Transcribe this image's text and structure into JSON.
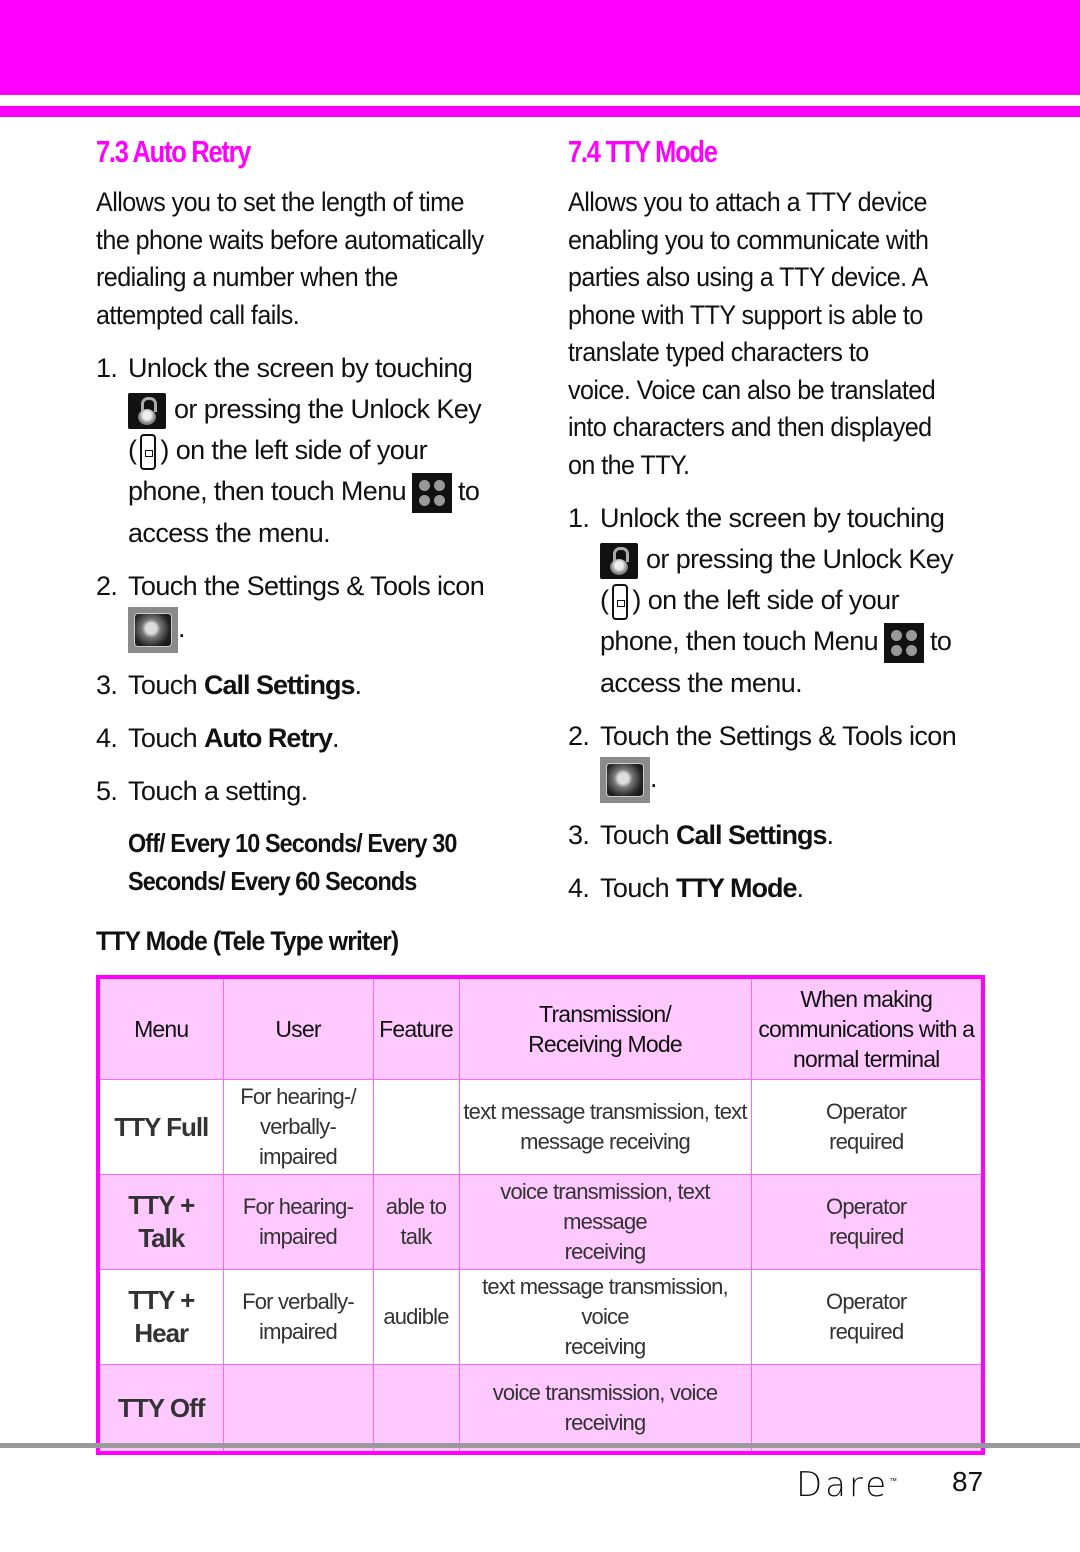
{
  "header": {
    "accent_color": "#ff00ff"
  },
  "left": {
    "title": "7.3 Auto Retry",
    "intro": [
      "Allows you to set the length of time",
      "the phone waits before automatically",
      "redialing a number when the",
      "attempted call fails."
    ],
    "steps": {
      "s1": {
        "num": "1.",
        "line1": "Unlock the screen by touching",
        "line2": "or pressing the Unlock Key",
        "line3_pre": "(",
        "line3_post": ") on the left side of your",
        "line4_pre": "phone, then touch Menu",
        "line4_post": "to",
        "line5": "access the menu."
      },
      "s2": {
        "num": "2.",
        "text": "Touch the Settings & Tools icon",
        "after_icon": "."
      },
      "s3": {
        "num": "3.",
        "pre": "Touch ",
        "bold": "Call Settings",
        "post": "."
      },
      "s4": {
        "num": "4.",
        "pre": "Touch ",
        "bold": "Auto Retry",
        "post": "."
      },
      "s5": {
        "num": "5.",
        "text": "Touch a setting."
      }
    },
    "options": [
      "Off/ Every 10 Seconds/ Every 30",
      "Seconds/ Every 60 Seconds"
    ]
  },
  "right": {
    "title": "7.4 TTY Mode",
    "intro": [
      "Allows you to attach a TTY device",
      "enabling you to communicate with",
      "parties also using a TTY device. A",
      "phone with TTY support is able to",
      "translate typed characters to",
      "voice. Voice can also be translated",
      "into characters and then displayed",
      "on the TTY."
    ],
    "steps": {
      "s1": {
        "num": "1.",
        "line1": "Unlock the screen by touching",
        "line2": "or pressing the Unlock Key",
        "line3_pre": "(",
        "line3_post": ") on the left side of your",
        "line4_pre": "phone, then touch Menu",
        "line4_post": "to",
        "line5": "access the menu."
      },
      "s2": {
        "num": "2.",
        "text": "Touch the Settings & Tools icon",
        "after_icon": "."
      },
      "s3": {
        "num": "3.",
        "pre": "Touch ",
        "bold": "Call Settings",
        "post": "."
      },
      "s4": {
        "num": "4.",
        "pre": "Touch ",
        "bold": "TTY Mode",
        "post": "."
      }
    }
  },
  "table": {
    "heading": "TTY Mode (Tele Type writer)",
    "headers": {
      "menu": "Menu",
      "user": "User",
      "feature": "Feature",
      "mode_l1": "Transmission/",
      "mode_l2": "Receiving Mode",
      "normal_l1": "When making",
      "normal_l2": "communications with a",
      "normal_l3": "normal terminal"
    },
    "rows": [
      {
        "menu": "TTY Full",
        "user_l1": "For hearing-/",
        "user_l2": "verbally-",
        "user_l3": "impaired",
        "feature_l1": "",
        "feature_l2": "",
        "mode_l1": "text message transmission, text",
        "mode_l2": "message receiving",
        "normal_l1": "Operator",
        "normal_l2": "required"
      },
      {
        "menu_l1": "TTY +",
        "menu_l2": "Talk",
        "user_l1": "For hearing-",
        "user_l2": "impaired",
        "feature_l1": "able to",
        "feature_l2": "talk",
        "mode_l1": "voice transmission, text message",
        "mode_l2": "receiving",
        "normal_l1": "Operator",
        "normal_l2": "required"
      },
      {
        "menu_l1": "TTY +",
        "menu_l2": "Hear",
        "user_l1": "For verbally-",
        "user_l2": "impaired",
        "feature_l1": "audible",
        "mode_l1": "text message transmission, voice",
        "mode_l2": "receiving",
        "normal_l1": "Operator",
        "normal_l2": "required"
      },
      {
        "menu": "TTY Off",
        "user": "",
        "feature": "",
        "mode": "voice transmission, voice receiving",
        "normal": ""
      }
    ]
  },
  "footer": {
    "brand": "Dare",
    "trademark": "™",
    "page_number": "87"
  }
}
